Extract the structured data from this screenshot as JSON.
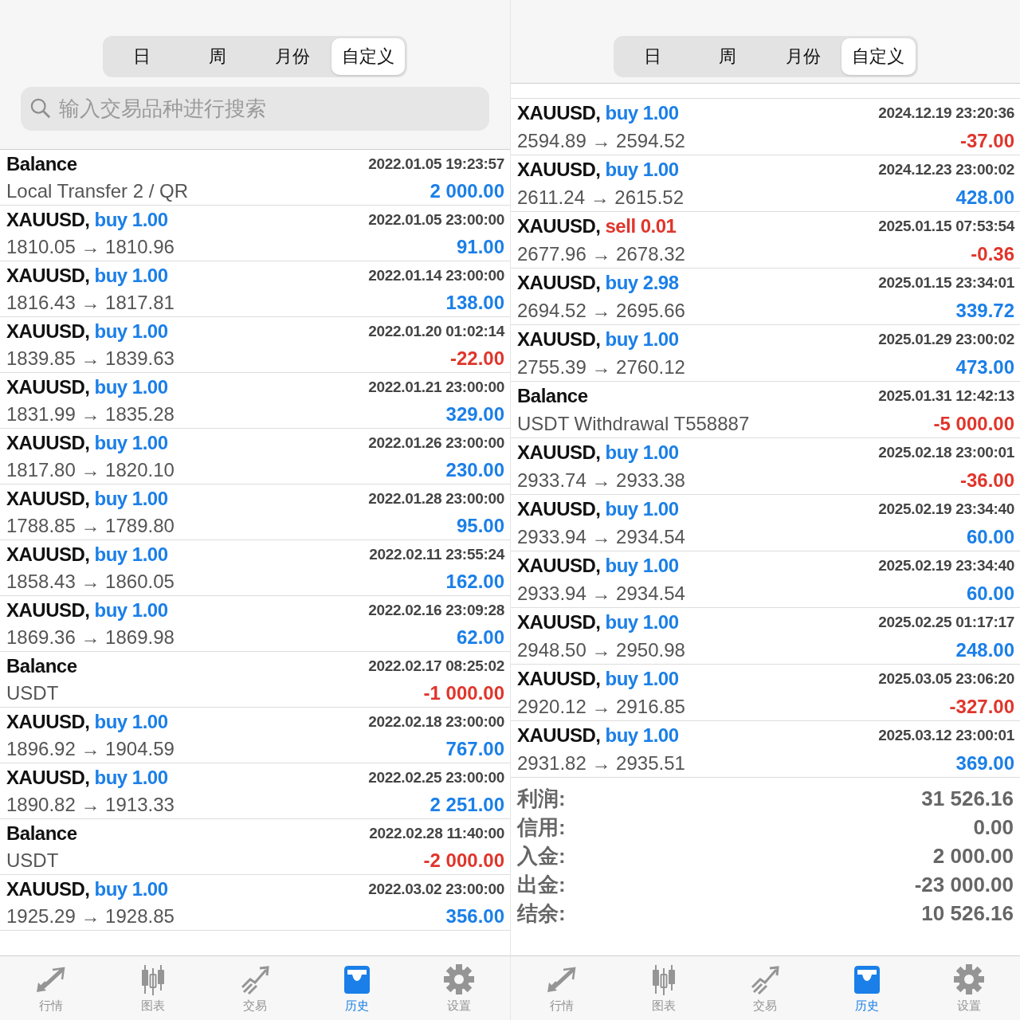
{
  "panels": [
    {
      "segments": [
        {
          "label": "日",
          "selected": false
        },
        {
          "label": "周",
          "selected": false
        },
        {
          "label": "月份",
          "selected": false
        },
        {
          "label": "自定义",
          "selected": true
        }
      ],
      "search": {
        "placeholder": "输入交易品种进行搜索"
      },
      "trades": [
        {
          "kind": "balance",
          "title": "Balance",
          "time": "2022.01.05 19:23:57",
          "detail": "Local Transfer 2 / QR",
          "profit": "2 000.00",
          "loss": false
        },
        {
          "kind": "trade",
          "title": "XAUUSD,",
          "order": "buy 1.00",
          "sell": false,
          "time": "2022.01.05 23:00:00",
          "detail": "1810.05 → 1810.96",
          "profit": "91.00",
          "loss": false
        },
        {
          "kind": "trade",
          "title": "XAUUSD,",
          "order": "buy 1.00",
          "sell": false,
          "time": "2022.01.14 23:00:00",
          "detail": "1816.43 → 1817.81",
          "profit": "138.00",
          "loss": false
        },
        {
          "kind": "trade",
          "title": "XAUUSD,",
          "order": "buy 1.00",
          "sell": false,
          "time": "2022.01.20 01:02:14",
          "detail": "1839.85 → 1839.63",
          "profit": "-22.00",
          "loss": true
        },
        {
          "kind": "trade",
          "title": "XAUUSD,",
          "order": "buy 1.00",
          "sell": false,
          "time": "2022.01.21 23:00:00",
          "detail": "1831.99 → 1835.28",
          "profit": "329.00",
          "loss": false
        },
        {
          "kind": "trade",
          "title": "XAUUSD,",
          "order": "buy 1.00",
          "sell": false,
          "time": "2022.01.26 23:00:00",
          "detail": "1817.80 → 1820.10",
          "profit": "230.00",
          "loss": false
        },
        {
          "kind": "trade",
          "title": "XAUUSD,",
          "order": "buy 1.00",
          "sell": false,
          "time": "2022.01.28 23:00:00",
          "detail": "1788.85 → 1789.80",
          "profit": "95.00",
          "loss": false
        },
        {
          "kind": "trade",
          "title": "XAUUSD,",
          "order": "buy 1.00",
          "sell": false,
          "time": "2022.02.11 23:55:24",
          "detail": "1858.43 → 1860.05",
          "profit": "162.00",
          "loss": false
        },
        {
          "kind": "trade",
          "title": "XAUUSD,",
          "order": "buy 1.00",
          "sell": false,
          "time": "2022.02.16 23:09:28",
          "detail": "1869.36 → 1869.98",
          "profit": "62.00",
          "loss": false
        },
        {
          "kind": "balance",
          "title": "Balance",
          "time": "2022.02.17 08:25:02",
          "detail": "USDT",
          "profit": "-1 000.00",
          "loss": true
        },
        {
          "kind": "trade",
          "title": "XAUUSD,",
          "order": "buy 1.00",
          "sell": false,
          "time": "2022.02.18 23:00:00",
          "detail": "1896.92 → 1904.59",
          "profit": "767.00",
          "loss": false
        },
        {
          "kind": "trade",
          "title": "XAUUSD,",
          "order": "buy 1.00",
          "sell": false,
          "time": "2022.02.25 23:00:00",
          "detail": "1890.82 → 1913.33",
          "profit": "2 251.00",
          "loss": false
        },
        {
          "kind": "balance",
          "title": "Balance",
          "time": "2022.02.28 11:40:00",
          "detail": "USDT",
          "profit": "-2 000.00",
          "loss": true
        },
        {
          "kind": "trade",
          "title": "XAUUSD,",
          "order": "buy 1.00",
          "sell": false,
          "time": "2022.03.02 23:00:00",
          "detail": "1925.29 → 1928.85",
          "profit": "356.00",
          "loss": false
        }
      ],
      "tab_bar": [
        {
          "label": "行情",
          "selected": false
        },
        {
          "label": "图表",
          "selected": false
        },
        {
          "label": "交易",
          "selected": false
        },
        {
          "label": "历史",
          "selected": true
        },
        {
          "label": "设置",
          "selected": false
        }
      ]
    },
    {
      "segments": [
        {
          "label": "日",
          "selected": false
        },
        {
          "label": "周",
          "selected": false
        },
        {
          "label": "月份",
          "selected": false
        },
        {
          "label": "自定义",
          "selected": true
        }
      ],
      "trades": [
        {
          "kind": "trade",
          "title": "XAUUSD,",
          "order": "buy 1.00",
          "sell": false,
          "time": "2024.12.19 23:20:36",
          "detail": "2594.89 → 2594.52",
          "profit": "-37.00",
          "loss": true
        },
        {
          "kind": "trade",
          "title": "XAUUSD,",
          "order": "buy 1.00",
          "sell": false,
          "time": "2024.12.23 23:00:02",
          "detail": "2611.24 → 2615.52",
          "profit": "428.00",
          "loss": false
        },
        {
          "kind": "trade",
          "title": "XAUUSD,",
          "order": "sell 0.01",
          "sell": true,
          "time": "2025.01.15 07:53:54",
          "detail": "2677.96 → 2678.32",
          "profit": "-0.36",
          "loss": true
        },
        {
          "kind": "trade",
          "title": "XAUUSD,",
          "order": "buy 2.98",
          "sell": false,
          "time": "2025.01.15 23:34:01",
          "detail": "2694.52 → 2695.66",
          "profit": "339.72",
          "loss": false
        },
        {
          "kind": "trade",
          "title": "XAUUSD,",
          "order": "buy 1.00",
          "sell": false,
          "time": "2025.01.29 23:00:02",
          "detail": "2755.39 → 2760.12",
          "profit": "473.00",
          "loss": false
        },
        {
          "kind": "balance",
          "title": "Balance",
          "time": "2025.01.31 12:42:13",
          "detail": "USDT Withdrawal T558887",
          "profit": "-5 000.00",
          "loss": true
        },
        {
          "kind": "trade",
          "title": "XAUUSD,",
          "order": "buy 1.00",
          "sell": false,
          "time": "2025.02.18 23:00:01",
          "detail": "2933.74 → 2933.38",
          "profit": "-36.00",
          "loss": true
        },
        {
          "kind": "trade",
          "title": "XAUUSD,",
          "order": "buy 1.00",
          "sell": false,
          "time": "2025.02.19 23:34:40",
          "detail": "2933.94 → 2934.54",
          "profit": "60.00",
          "loss": false
        },
        {
          "kind": "trade",
          "title": "XAUUSD,",
          "order": "buy 1.00",
          "sell": false,
          "time": "2025.02.19 23:34:40",
          "detail": "2933.94 → 2934.54",
          "profit": "60.00",
          "loss": false
        },
        {
          "kind": "trade",
          "title": "XAUUSD,",
          "order": "buy 1.00",
          "sell": false,
          "time": "2025.02.25 01:17:17",
          "detail": "2948.50 → 2950.98",
          "profit": "248.00",
          "loss": false
        },
        {
          "kind": "trade",
          "title": "XAUUSD,",
          "order": "buy 1.00",
          "sell": false,
          "time": "2025.03.05 23:06:20",
          "detail": "2920.12 → 2916.85",
          "profit": "-327.00",
          "loss": true
        },
        {
          "kind": "trade",
          "title": "XAUUSD,",
          "order": "buy 1.00",
          "sell": false,
          "time": "2025.03.12 23:00:01",
          "detail": "2931.82 → 2935.51",
          "profit": "369.00",
          "loss": false
        }
      ],
      "summary": [
        {
          "label": "利润:",
          "value": "31 526.16"
        },
        {
          "label": "信用:",
          "value": "0.00"
        },
        {
          "label": "入金:",
          "value": "2 000.00"
        },
        {
          "label": "出金:",
          "value": "-23 000.00"
        },
        {
          "label": "结余:",
          "value": "10 526.16"
        }
      ],
      "tab_bar": [
        {
          "label": "行情",
          "selected": false
        },
        {
          "label": "图表",
          "selected": false
        },
        {
          "label": "交易",
          "selected": false
        },
        {
          "label": "历史",
          "selected": true
        },
        {
          "label": "设置",
          "selected": false
        }
      ]
    }
  ]
}
